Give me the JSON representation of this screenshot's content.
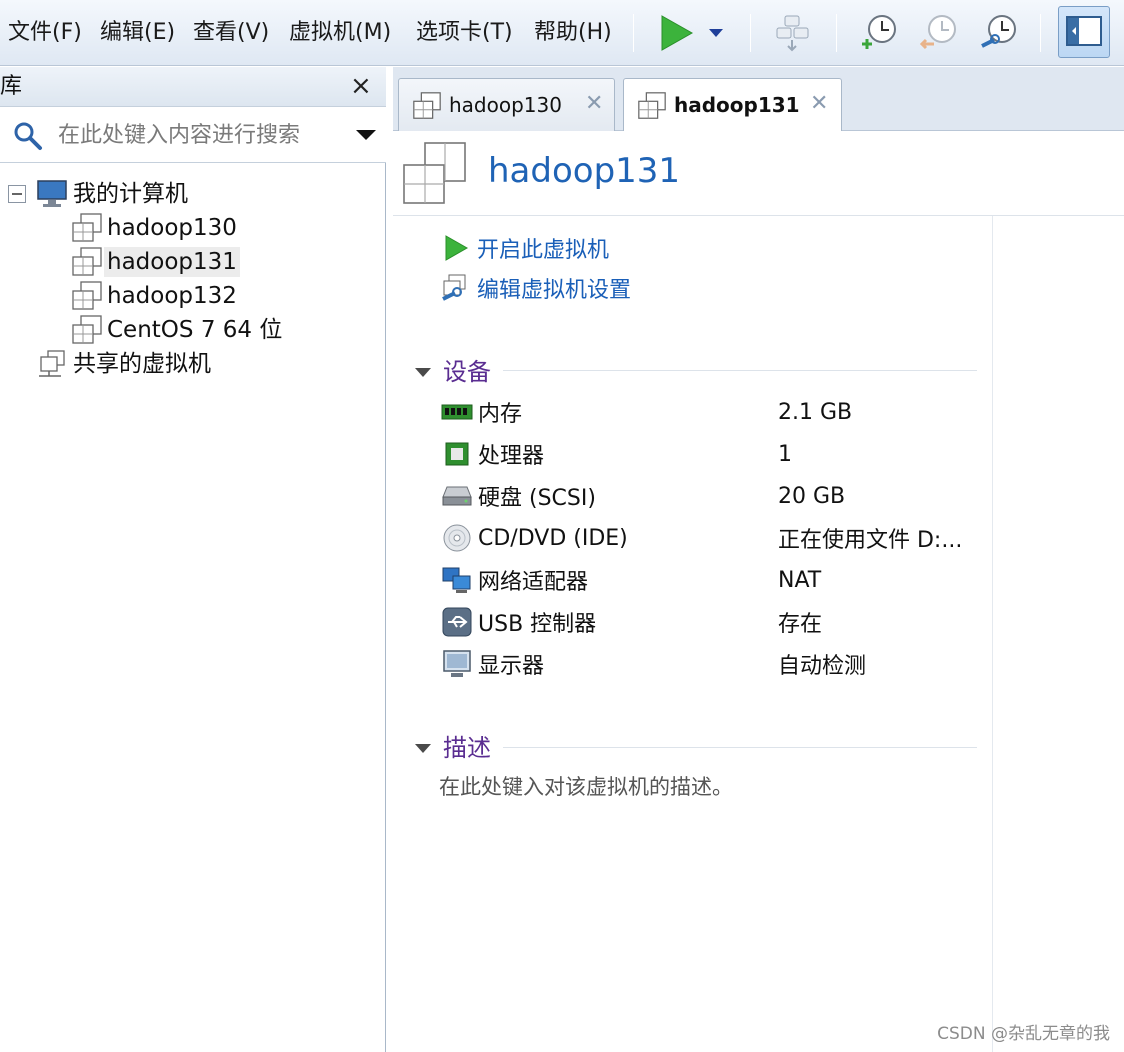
{
  "menu": {
    "items": [
      "文件(F)",
      "编辑(E)",
      "查看(V)",
      "虚拟机(M)",
      "选项卡(T)",
      "帮助(H)"
    ]
  },
  "toolbar": {
    "icons": [
      "play-icon",
      "dropdown-arrow-icon",
      "send-keys-icon",
      "snapshot-take-icon",
      "snapshot-revert-icon",
      "snapshot-manager-icon",
      "library-toggle-icon"
    ]
  },
  "library": {
    "title": "库",
    "close": "×",
    "search_placeholder": "在此处键入内容进行搜索",
    "tree": {
      "root": "我的计算机",
      "items": [
        "hadoop130",
        "hadoop131",
        "hadoop132",
        "CentOS 7 64 位"
      ],
      "shared": "共享的虚拟机"
    }
  },
  "tabs": [
    {
      "label": "hadoop130",
      "close": "✕"
    },
    {
      "label": "hadoop131",
      "close": "✕"
    }
  ],
  "vm": {
    "name": "hadoop131",
    "actions": [
      "开启此虚拟机",
      "编辑虚拟机设置"
    ],
    "devices_title": "设备",
    "devices": [
      {
        "name": "内存",
        "value": "2.1 GB",
        "icon": "memory-icon"
      },
      {
        "name": "处理器",
        "value": "1",
        "icon": "processor-icon"
      },
      {
        "name": "硬盘 (SCSI)",
        "value": "20 GB",
        "icon": "harddisk-icon"
      },
      {
        "name": "CD/DVD (IDE)",
        "value": "正在使用文件 D:...",
        "icon": "cd-dvd-icon"
      },
      {
        "name": "网络适配器",
        "value": "NAT",
        "icon": "network-adapter-icon"
      },
      {
        "name": "USB 控制器",
        "value": "存在",
        "icon": "usb-icon"
      },
      {
        "name": "显示器",
        "value": "自动检测",
        "icon": "display-icon"
      }
    ],
    "description_title": "描述",
    "description_placeholder": "在此处键入对该虚拟机的描述。"
  },
  "watermark": "CSDN @杂乱无章的我",
  "colors": {
    "accent": "#1f63b5",
    "section": "#5a2d91",
    "play": "#3cb33c"
  }
}
